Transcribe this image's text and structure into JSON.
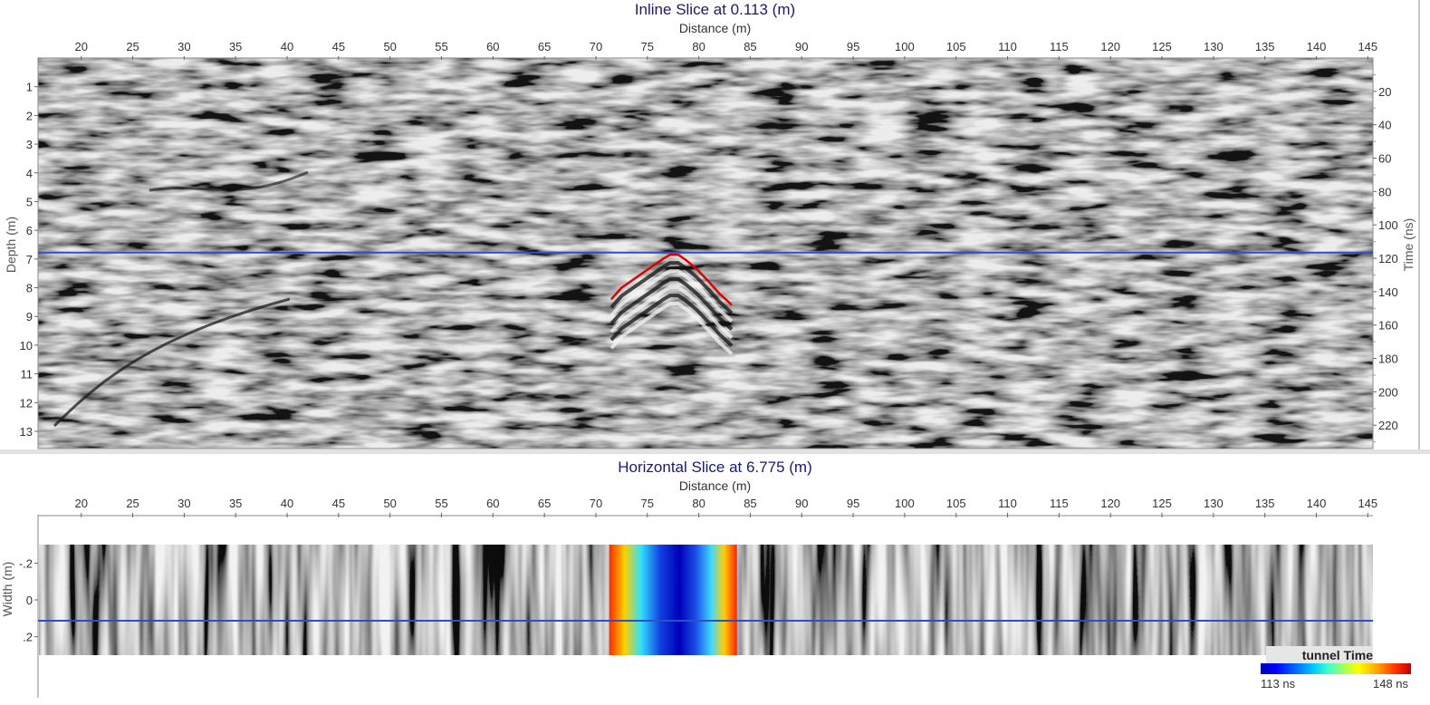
{
  "top_panel": {
    "title": "Inline Slice at 0.113 (m)",
    "xlabel": "Distance (m)",
    "ylabel_left": "Depth (m)",
    "ylabel_right": "Time (ns)"
  },
  "bottom_panel": {
    "title": "Horizontal Slice at 6.775 (m)",
    "xlabel": "Distance (m)",
    "ylabel": "Width (m)"
  },
  "legend": {
    "title": "tunnel Time",
    "min_label": "113 ns",
    "max_label": "148 ns"
  },
  "colors": {
    "title": "#1a1a6e",
    "slice_line": "#2e4fc8",
    "pick_line": "#e00000"
  },
  "chart_data": [
    {
      "type": "heatmap",
      "title": "Inline Slice at 0.113 (m)",
      "xlabel": "Distance (m)",
      "ylabel": "Depth (m)",
      "ylabel_secondary": "Time (ns)",
      "colormap": "grayscale",
      "x_ticks": [
        20,
        25,
        30,
        35,
        40,
        45,
        50,
        55,
        60,
        65,
        70,
        75,
        80,
        85,
        90,
        95,
        100,
        105,
        110,
        115,
        120,
        125,
        130,
        135,
        140,
        145
      ],
      "y_ticks": [
        1,
        2,
        3,
        4,
        5,
        6,
        7,
        8,
        9,
        10,
        11,
        12,
        13
      ],
      "y2_ticks": [
        20,
        40,
        60,
        80,
        100,
        120,
        140,
        160,
        180,
        200,
        220
      ],
      "xlim": [
        15.8,
        145.5
      ],
      "ylim": [
        13.6,
        0.0
      ],
      "y2lim": [
        0,
        234
      ],
      "horizontal_slice_depth": 6.775,
      "picked_hyperbola": {
        "x": [
          71.5,
          72.5,
          73.5,
          74.5,
          75.5,
          76.5,
          77.2,
          78.0,
          78.8,
          79.8,
          81.0,
          82.0,
          83.2
        ],
        "y": [
          8.4,
          8.0,
          7.75,
          7.5,
          7.25,
          7.0,
          6.85,
          6.85,
          7.05,
          7.35,
          7.8,
          8.2,
          8.6
        ]
      }
    },
    {
      "type": "heatmap",
      "title": "Horizontal Slice at 6.775 (m)",
      "xlabel": "Distance (m)",
      "ylabel": "Width (m)",
      "colormap": "grayscale",
      "x_ticks": [
        20,
        25,
        30,
        35,
        40,
        45,
        50,
        55,
        60,
        65,
        70,
        75,
        80,
        85,
        90,
        95,
        100,
        105,
        110,
        115,
        120,
        125,
        130,
        135,
        140,
        145
      ],
      "y_ticks": [
        -0.2,
        0,
        0.2
      ],
      "xlim": [
        15.8,
        145.5
      ],
      "ylim": [
        -0.3,
        0.3
      ],
      "inline_slice_width": 0.113,
      "tunnel_time_overlay": {
        "x_range": [
          71.3,
          83.7
        ],
        "colormap": "jet",
        "value_range_ns": [
          113,
          148
        ]
      }
    }
  ]
}
